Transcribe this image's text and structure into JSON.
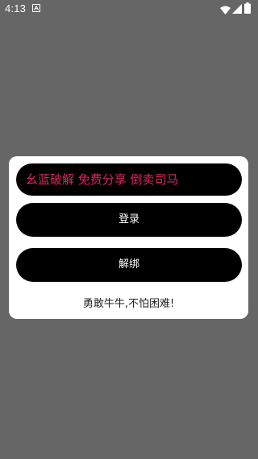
{
  "status_bar": {
    "time": "4:13",
    "icons": [
      "notification-a-icon",
      "wifi-icon",
      "signal-icon",
      "battery-icon"
    ]
  },
  "dialog": {
    "banner_text": "幺蓝破解 免费分享 倒卖司马",
    "login_label": "登录",
    "unbind_label": "解绑",
    "slogan": "勇敢牛牛,不怕困难!"
  },
  "colors": {
    "background": "#666666",
    "dialog": "#ffffff",
    "button": "#000000",
    "banner_text": "#e0245e"
  }
}
